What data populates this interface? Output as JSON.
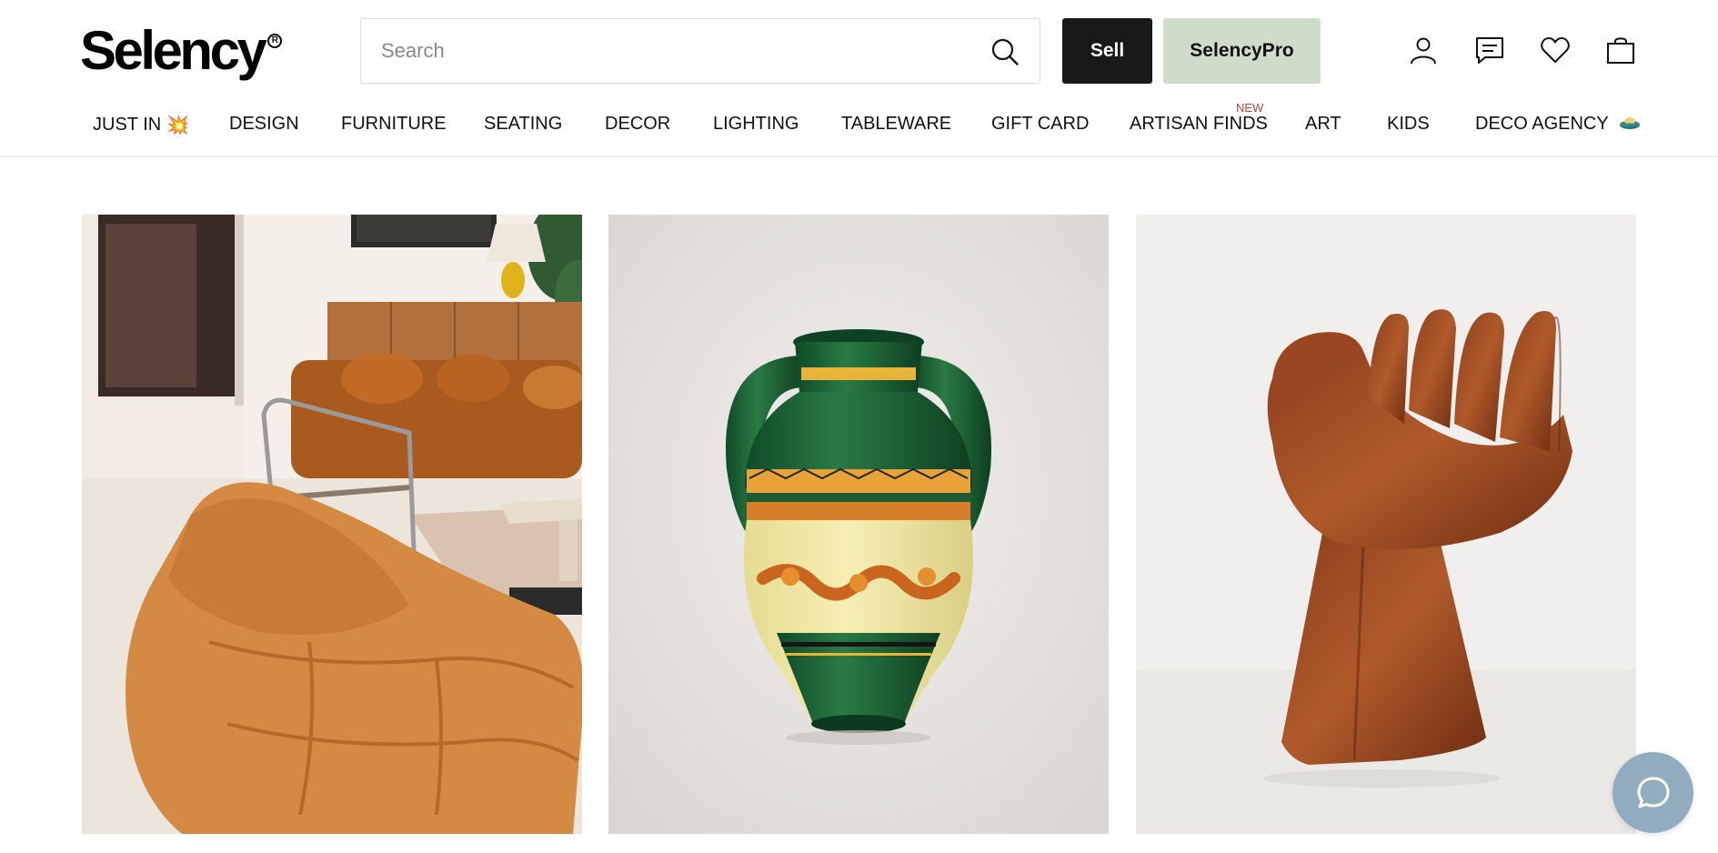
{
  "brand": {
    "logo_text": "Selency",
    "logo_mark": "R"
  },
  "search": {
    "placeholder": "Search",
    "value": ""
  },
  "actions": {
    "sell_label": "Sell",
    "pro_label": "SelencyPro"
  },
  "header_icons": [
    "account-icon",
    "messages-icon",
    "favorites-heart-icon",
    "shopping-bag-icon"
  ],
  "nav": {
    "items": [
      {
        "label": "JUST IN",
        "emoji": "💥"
      },
      {
        "label": "DESIGN"
      },
      {
        "label": "FURNITURE"
      },
      {
        "label": "SEATING"
      },
      {
        "label": "DECOR"
      },
      {
        "label": "LIGHTING"
      },
      {
        "label": "TABLEWARE"
      },
      {
        "label": "GIFT CARD"
      },
      {
        "label": "ARTISAN FINDS",
        "badge": "NEW"
      },
      {
        "label": "ART"
      },
      {
        "label": "KIDS"
      },
      {
        "label": "DECO AGENCY"
      }
    ]
  },
  "colors": {
    "sell_bg": "#17191a",
    "pro_bg": "#cfdcc9",
    "badge": "#b34a3a",
    "chat_bg": "#8ea9bd"
  }
}
